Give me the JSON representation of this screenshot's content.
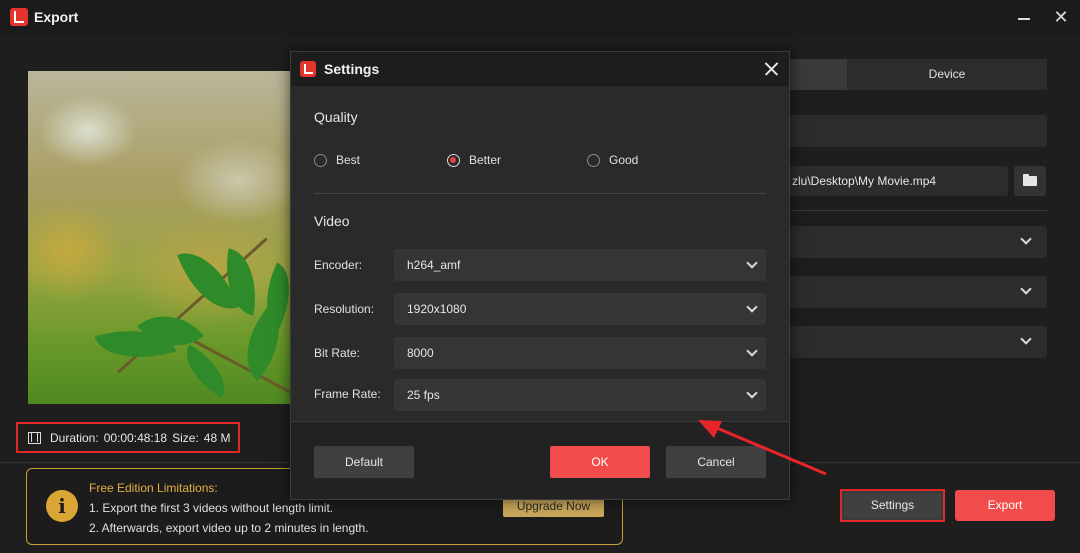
{
  "window": {
    "title": "Export"
  },
  "preview": {
    "duration_label": "Duration:",
    "duration_value": "00:00:48:18",
    "size_label": "Size:",
    "size_value": "48 M"
  },
  "free_edition": {
    "title": "Free Edition Limitations:",
    "line1": "1. Export the first 3 videos without length limit.",
    "line2": "2. Afterwards, export video up to 2 minutes in length.",
    "upgrade_label": "Upgrade Now"
  },
  "right_panel": {
    "tab_device": "Device",
    "path_value": "zlu\\Desktop\\My Movie.mp4"
  },
  "footer": {
    "settings_label": "Settings",
    "export_label": "Export"
  },
  "dialog": {
    "title": "Settings",
    "quality": {
      "title": "Quality",
      "options": [
        "Best",
        "Better",
        "Good"
      ],
      "selected": "Better"
    },
    "video": {
      "title": "Video",
      "encoder_label": "Encoder:",
      "encoder_value": "h264_amf",
      "resolution_label": "Resolution:",
      "resolution_value": "1920x1080",
      "bitrate_label": "Bit Rate:",
      "bitrate_value": "8000",
      "framerate_label": "Frame Rate:",
      "framerate_value": "25 fps"
    },
    "buttons": {
      "default_label": "Default",
      "ok_label": "OK",
      "cancel_label": "Cancel"
    }
  },
  "colors": {
    "accent_red": "#f24b4b",
    "highlight_red": "#e0282a",
    "warning_gold": "#c9a030"
  },
  "icons": [
    "app-logo-icon",
    "minimize-icon",
    "close-icon",
    "film-icon",
    "info-icon",
    "folder-icon",
    "chevron-down-icon",
    "arrow-annotation-icon"
  ]
}
